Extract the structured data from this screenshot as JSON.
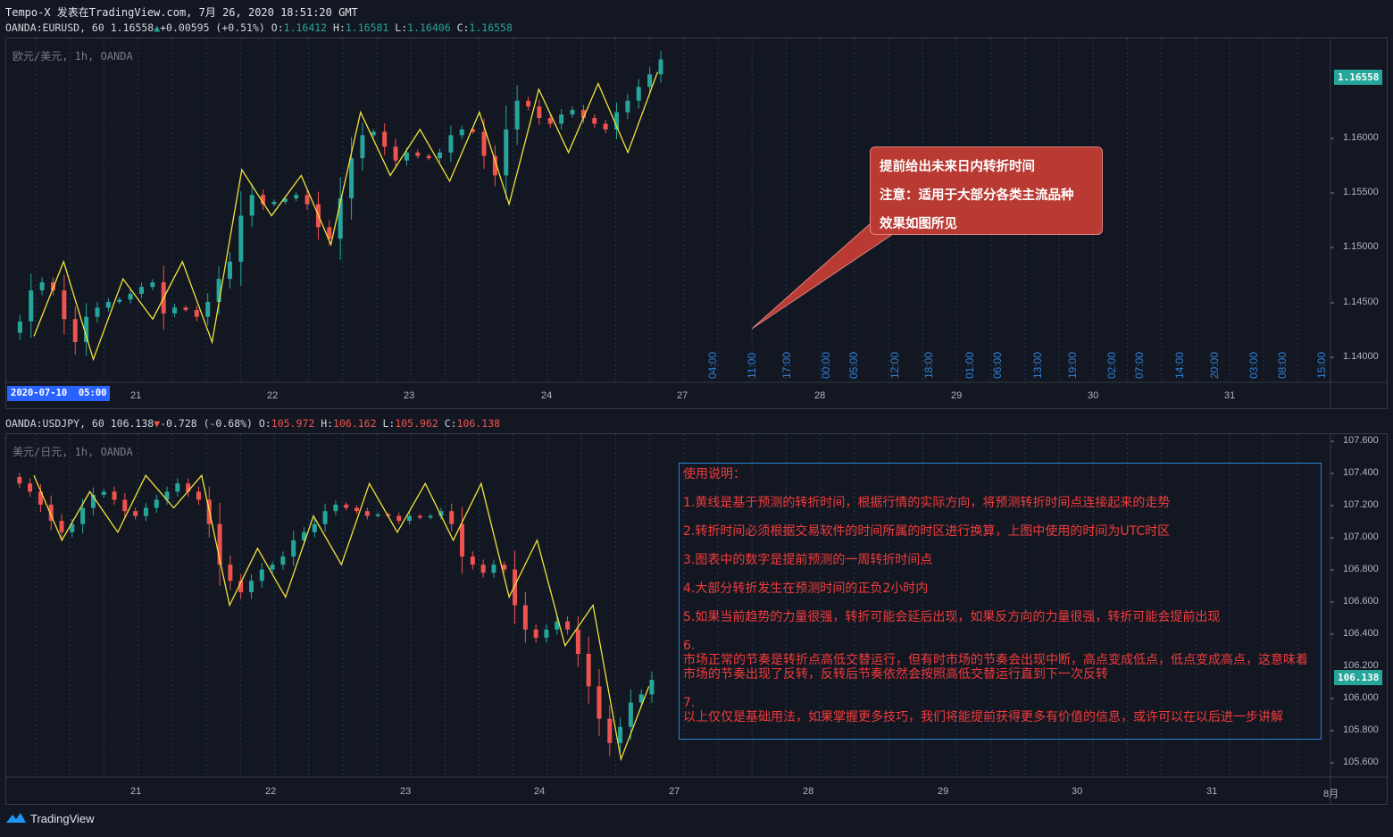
{
  "header": {
    "line": "Tempo-X 发表在TradingView.com, 7月 26, 2020 18:51:20 GMT"
  },
  "top_pane": {
    "symbol": "OANDA:EURUSD, 60",
    "last": "1.16558",
    "change": "+0.00595 (+0.51%)",
    "o_label": "O:",
    "o": "1.16412",
    "h_label": "H:",
    "h": "1.16581",
    "l_label": "L:",
    "l": "1.16406",
    "c_label": "C:",
    "c": "1.16558",
    "watermark": "欧元/美元, 1h, OANDA",
    "price_tag": "1.16558",
    "time_tag": "2020-07-10  05:00",
    "price_axis": [
      "1.16000",
      "1.15500",
      "1.15000",
      "1.14500",
      "1.14000"
    ],
    "date_axis": [
      "21",
      "22",
      "23",
      "24",
      "27",
      "28",
      "29",
      "30",
      "31"
    ],
    "forecast_times": [
      "04:00",
      "11:00",
      "17:00",
      "00:00",
      "05:00",
      "12:00",
      "18:00",
      "01:00",
      "06:00",
      "13:00",
      "19:00",
      "02:00",
      "07:00",
      "14:00",
      "20:00",
      "03:00",
      "08:00",
      "15:00"
    ],
    "callout": [
      "提前给出未来日内转折时间",
      "注意：适用于大部分各类主流品种",
      "效果如图所见"
    ]
  },
  "bottom_pane": {
    "symbol": "OANDA:USDJPY, 60",
    "last": "106.138",
    "change": "-0.728 (-0.68%)",
    "o_label": "O:",
    "o": "105.972",
    "h_label": "H:",
    "h": "106.162",
    "l_label": "L:",
    "l": "105.962",
    "c_label": "C:",
    "c": "106.138",
    "watermark": "美元/日元, 1h, OANDA",
    "price_tag": "106.138",
    "hidden_tick": "106.200",
    "price_axis": [
      "107.600",
      "107.400",
      "107.200",
      "107.000",
      "106.800",
      "106.600",
      "106.400",
      "106.000",
      "105.800",
      "105.600"
    ],
    "date_axis": [
      "21",
      "22",
      "23",
      "24",
      "27",
      "28",
      "29",
      "30",
      "31",
      "8月"
    ],
    "notes": [
      "使用说明：",
      "1.黄线是基于预测的转折时间，根据行情的实际方向，将预测转折时间点连接起来的走势",
      "2.转折时间必须根据交易软件的时间所属的时区进行换算，上图中使用的时间为UTC时区",
      "3.图表中的数字是提前预测的一周转折时间点",
      "4.大部分转折发生在预测时间的正负2小时内",
      "5.如果当前趋势的力量很强，转折可能会延后出现，如果反方向的力量很强，转折可能会提前出现",
      "6.",
      "市场正常的节奏是转折点高低交替运行，但有时市场的节奏会出现中断，高点变成低点，低点变成高点，这意味着市场的节奏出现了反转，反转后节奏依然会按照高低交替运行直到下一次反转",
      "7.",
      "以上仅仅是基础用法，如果掌握更多技巧，我们将能提前获得更多有价值的信息，或许可以在以后进一步讲解"
    ]
  },
  "footer": {
    "brand": "TradingView"
  },
  "colors": {
    "up": "#26a69a",
    "down": "#ef5350",
    "zigzag": "#f2e33a",
    "background": "#131722",
    "callout": "#b93a33",
    "notes_border": "#2f7fd6",
    "notes_text": "#f23b3b"
  },
  "chart_data": [
    {
      "type": "candlestick",
      "symbol": "OANDA:EURUSD",
      "title": "欧元/美元, 1h, OANDA",
      "ylim": [
        1.1375,
        1.1675
      ],
      "x_categories": [
        "21",
        "22",
        "23",
        "24",
        "27",
        "28",
        "29",
        "30",
        "31"
      ],
      "y_ticks": [
        1.16,
        1.155,
        1.15,
        1.145,
        1.14
      ],
      "zigzag_series": [
        1.1415,
        1.148,
        1.1395,
        1.1465,
        1.143,
        1.148,
        1.141,
        1.156,
        1.152,
        1.1555,
        1.1495,
        1.161,
        1.1555,
        1.1595,
        1.155,
        1.161,
        1.153,
        1.163,
        1.1575,
        1.1635,
        1.1575,
        1.1645
      ],
      "close_series": [
        1.1418,
        1.1428,
        1.1455,
        1.1462,
        1.1455,
        1.143,
        1.141,
        1.1432,
        1.144,
        1.1445,
        1.1447,
        1.1452,
        1.1458,
        1.1462,
        1.1435,
        1.144,
        1.1438,
        1.1432,
        1.1445,
        1.1465,
        1.148,
        1.152,
        1.1538,
        1.153,
        1.1532,
        1.1535,
        1.1538,
        1.153,
        1.151,
        1.15,
        1.1535,
        1.157,
        1.159,
        1.1593,
        1.158,
        1.1568,
        1.1575,
        1.1572,
        1.157,
        1.1575,
        1.159,
        1.1595,
        1.1593,
        1.1572,
        1.1555,
        1.1595,
        1.162,
        1.1615,
        1.1605,
        1.16,
        1.1608,
        1.1612,
        1.1605,
        1.16,
        1.1595,
        1.161,
        1.162,
        1.1632,
        1.1643,
        1.1656
      ]
    },
    {
      "type": "candlestick",
      "symbol": "OANDA:USDJPY",
      "title": "美元/日元, 1h, OANDA",
      "ylim": [
        105.54,
        107.66
      ],
      "x_categories": [
        "21",
        "22",
        "23",
        "24",
        "27",
        "28",
        "29",
        "30",
        "31",
        "8月"
      ],
      "y_ticks": [
        107.6,
        107.4,
        107.2,
        107.0,
        106.8,
        106.6,
        106.4,
        106.2,
        106.0,
        105.8,
        105.6
      ],
      "zigzag_series": [
        107.4,
        107.0,
        107.3,
        107.05,
        107.4,
        107.2,
        107.4,
        106.6,
        106.95,
        106.65,
        107.15,
        106.85,
        107.35,
        107.05,
        107.35,
        107.0,
        107.35,
        106.65,
        107.0,
        106.35,
        106.6,
        105.65,
        106.1
      ],
      "close_series": [
        107.39,
        107.35,
        107.3,
        107.22,
        107.12,
        107.05,
        107.1,
        107.2,
        107.28,
        107.3,
        107.25,
        107.18,
        107.15,
        107.2,
        107.25,
        107.3,
        107.35,
        107.3,
        107.25,
        107.1,
        106.85,
        106.75,
        106.68,
        106.75,
        106.82,
        106.85,
        106.9,
        107.0,
        107.05,
        107.1,
        107.18,
        107.22,
        107.2,
        107.18,
        107.15,
        107.16,
        107.15,
        107.12,
        107.15,
        107.14,
        107.15,
        107.18,
        107.1,
        106.9,
        106.85,
        106.8,
        106.85,
        106.82,
        106.6,
        106.45,
        106.4,
        106.45,
        106.5,
        106.45,
        106.3,
        106.1,
        105.9,
        105.75,
        105.85,
        106.0,
        106.05,
        106.14
      ]
    }
  ]
}
